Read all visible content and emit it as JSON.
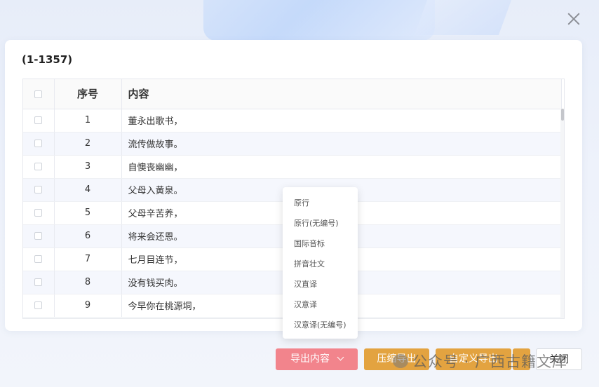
{
  "dialog": {
    "range_label": "(1-1357)"
  },
  "table": {
    "headers": {
      "index": "序号",
      "content": "内容"
    },
    "rows": [
      {
        "index": "1",
        "content": "董永出歌书，"
      },
      {
        "index": "2",
        "content": "流传做故事。"
      },
      {
        "index": "3",
        "content": "自懊丧幽幽，"
      },
      {
        "index": "4",
        "content": "父母入黄泉。"
      },
      {
        "index": "5",
        "content": "父母辛苦养，"
      },
      {
        "index": "6",
        "content": "将来会还恩。"
      },
      {
        "index": "7",
        "content": "七月目连节，"
      },
      {
        "index": "8",
        "content": "没有钱买肉。"
      },
      {
        "index": "9",
        "content": "今早你在桃源垌，"
      }
    ]
  },
  "export_menu": {
    "items": [
      "原行",
      "原行(无编号)",
      "国际音标",
      "拼音壮文",
      "汉直译",
      "汉意译",
      "汉意译(无编号)"
    ]
  },
  "footer": {
    "export_label": "导出内容",
    "zip_label": "压缩导出",
    "custom_label": "自定义导出",
    "close_label": "关闭"
  },
  "watermark": "公众号 · 广西古籍文库",
  "colors": {
    "export_button": "#f2848c",
    "secondary_button": "#e3a340",
    "alt_row": "#f5f7fd"
  }
}
